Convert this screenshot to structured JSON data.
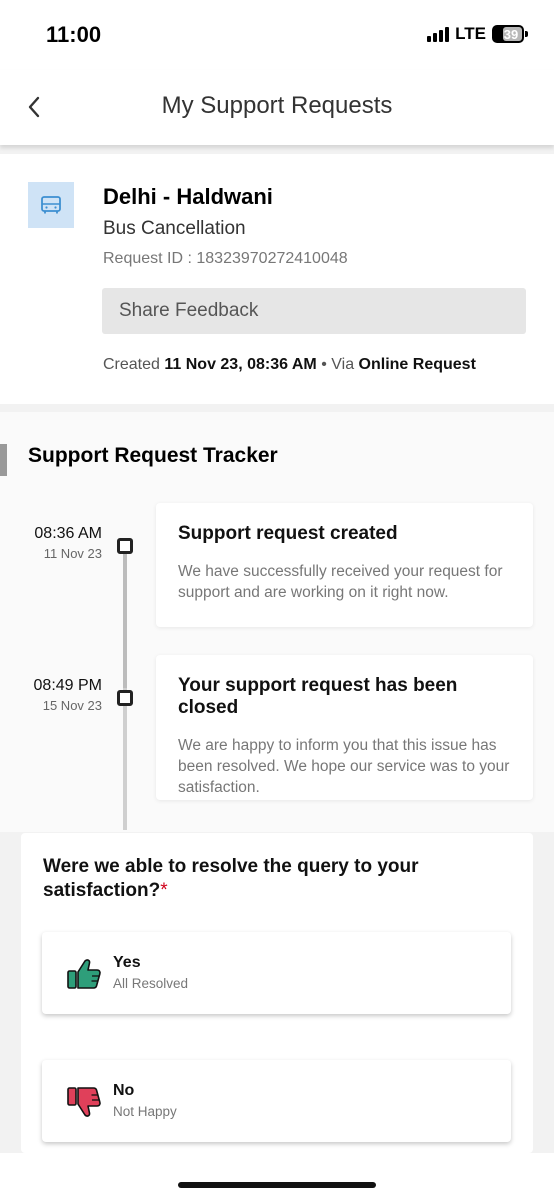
{
  "status": {
    "time": "11:00",
    "network": "LTE",
    "battery": "39"
  },
  "header": {
    "title": "My Support Requests"
  },
  "request": {
    "route": "Delhi - Haldwani",
    "category": "Bus Cancellation",
    "request_id": "Request ID : 18323970272410048",
    "share_feedback": "Share Feedback",
    "created_label": "Created",
    "created_value": "11 Nov 23, 08:36 AM",
    "via_label": "• Via",
    "via_value": "Online Request"
  },
  "tracker": {
    "title": "Support Request Tracker",
    "events": [
      {
        "time": "08:36 AM",
        "date": "11 Nov 23",
        "title": "Support request created",
        "desc": "We have successfully received your request for support and are working on it right now."
      },
      {
        "time": "08:49 PM",
        "date": "15 Nov 23",
        "title": "Your support request has been closed",
        "desc": "We are happy to inform you that this issue has been resolved. We hope our service was to your satisfaction."
      }
    ]
  },
  "satisfaction": {
    "question": "Were we able to resolve the query to your satisfaction?",
    "required_mark": "*",
    "options": [
      {
        "label": "Yes",
        "sub": "All Resolved",
        "icon": "thumbs-up-icon",
        "color": "#2e9e7a"
      },
      {
        "label": "No",
        "sub": "Not Happy",
        "icon": "thumbs-down-icon",
        "color": "#e0405a"
      }
    ]
  },
  "colors": {
    "icon_box": "#cfe3f6",
    "bus_icon": "#3d8fd1"
  }
}
